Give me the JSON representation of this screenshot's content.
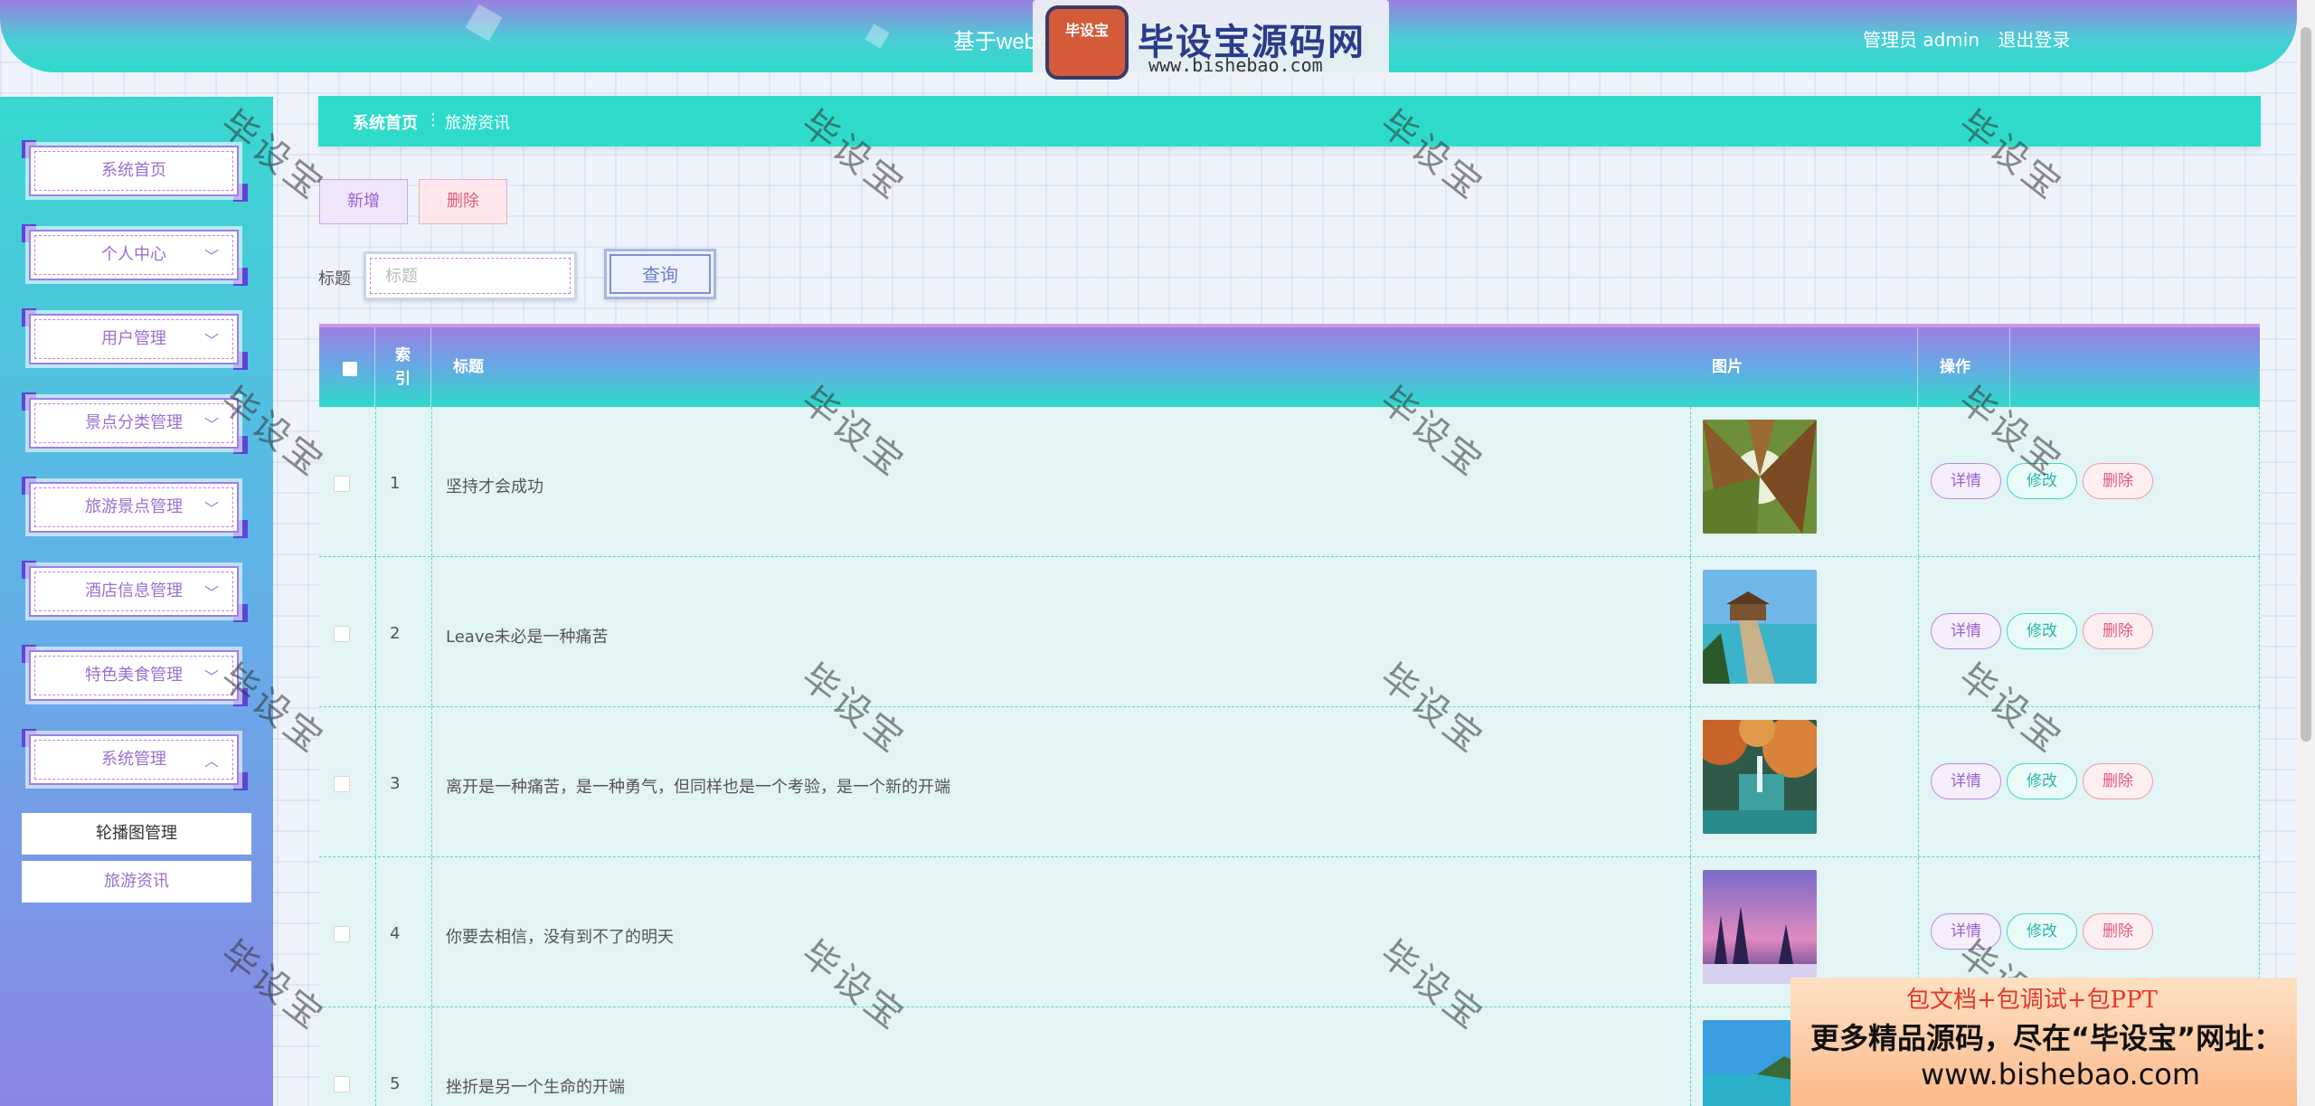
{
  "header": {
    "app_title": "基于web的旅游网站",
    "role_label": "管理员 admin",
    "logout_label": "退出登录"
  },
  "watermark_logo": {
    "badge": "毕设宝",
    "text": "毕设宝源码网",
    "url": "www.bishebao.com"
  },
  "sidebar": {
    "items": [
      {
        "label": "系统首页",
        "chevron": ""
      },
      {
        "label": "个人中心",
        "chevron": "﹀"
      },
      {
        "label": "用户管理",
        "chevron": "﹀"
      },
      {
        "label": "景点分类管理",
        "chevron": "﹀"
      },
      {
        "label": "旅游景点管理",
        "chevron": "﹀"
      },
      {
        "label": "酒店信息管理",
        "chevron": "﹀"
      },
      {
        "label": "特色美食管理",
        "chevron": "﹀"
      },
      {
        "label": "系统管理",
        "chevron": "︿"
      }
    ],
    "sub_items": [
      {
        "label": "轮播图管理"
      },
      {
        "label": "旅游资讯"
      }
    ]
  },
  "breadcrumb": {
    "home": "系统首页",
    "separator": "⋮",
    "current": "旅游资讯"
  },
  "actions": {
    "add_label": "新增",
    "delete_label": "删除"
  },
  "search": {
    "label": "标题",
    "placeholder": "标题",
    "value": "",
    "button_label": "查询"
  },
  "table": {
    "headers": {
      "index": "索\n引",
      "title": "标题",
      "image": "图片",
      "actions": "操作"
    },
    "rows": [
      {
        "index": "1",
        "title": "坚持才会成功"
      },
      {
        "index": "2",
        "title": "Leave未必是一种痛苦"
      },
      {
        "index": "3",
        "title": "离开是一种痛苦，是一种勇气，但同样也是一个考验，是一个新的开端"
      },
      {
        "index": "4",
        "title": "你要去相信，没有到不了的明天"
      },
      {
        "index": "5",
        "title": "挫折是另一个生命的开端"
      }
    ],
    "row_buttons": {
      "detail": "详情",
      "edit": "修改",
      "delete": "删除"
    }
  },
  "watermark_text": "毕设宝",
  "ad": {
    "line1": "包文档+包调试+包PPT",
    "line2": "更多精品源码，尽在“毕设宝”网址：",
    "line3": "www.bishebao.com"
  },
  "colors": {
    "accent_teal": "#2edbcb",
    "accent_purple": "#9b7fe0",
    "detail": "#9a5fd0",
    "edit": "#28b6a6",
    "delete": "#e05a78"
  }
}
